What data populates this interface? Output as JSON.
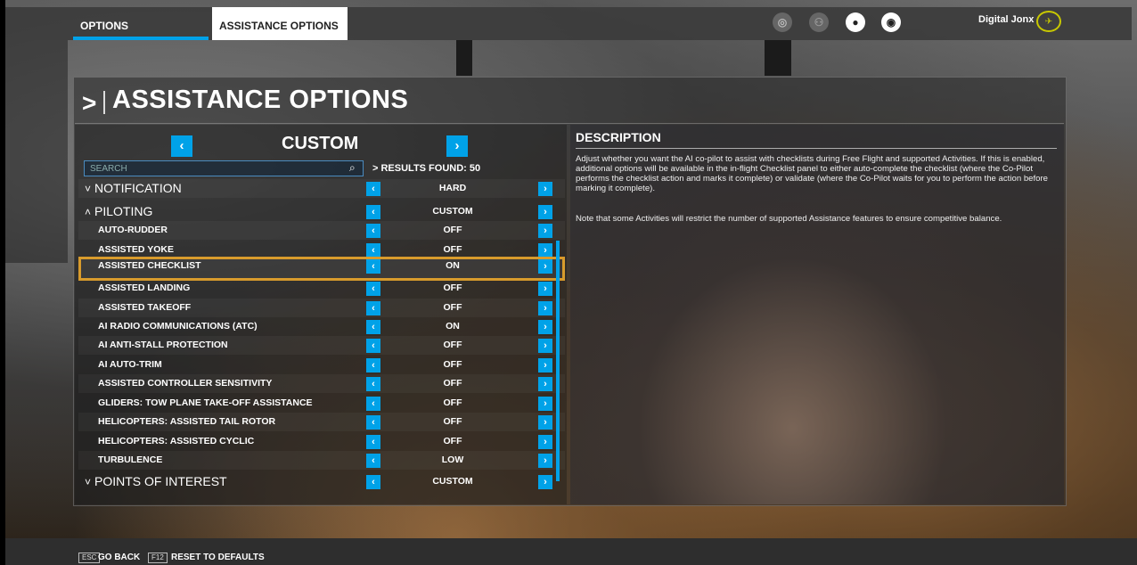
{
  "top_bar": {
    "tab_options": "OPTIONS",
    "tab_assistance": "ASSISTANCE OPTIONS",
    "username": "Digital Jonx",
    "icons": [
      "achievements-icon",
      "friends-icon",
      "profile-icon",
      "notifications-icon"
    ]
  },
  "page": {
    "title": "ASSISTANCE OPTIONS",
    "preset": "CUSTOM",
    "search_placeholder": "SEARCH",
    "results": "RESULTS FOUND: 50"
  },
  "rows": [
    {
      "label": "NOTIFICATION",
      "value": "HARD",
      "type": "category",
      "marker": "˅"
    },
    {
      "label": "PILOTING",
      "value": "CUSTOM",
      "type": "category",
      "marker": "˄"
    },
    {
      "label": "AUTO-RUDDER",
      "value": "OFF",
      "type": "item"
    },
    {
      "label": "ASSISTED YOKE",
      "value": "OFF",
      "type": "item"
    },
    {
      "label": "ASSISTED CHECKLIST",
      "value": "ON",
      "type": "item",
      "selected": true
    },
    {
      "label": "ASSISTED LANDING",
      "value": "OFF",
      "type": "item"
    },
    {
      "label": "ASSISTED TAKEOFF",
      "value": "OFF",
      "type": "item"
    },
    {
      "label": "AI RADIO COMMUNICATIONS (ATC)",
      "value": "ON",
      "type": "item"
    },
    {
      "label": "AI ANTI-STALL PROTECTION",
      "value": "OFF",
      "type": "item"
    },
    {
      "label": "AI AUTO-TRIM",
      "value": "OFF",
      "type": "item"
    },
    {
      "label": "ASSISTED CONTROLLER SENSITIVITY",
      "value": "OFF",
      "type": "item"
    },
    {
      "label": "GLIDERS: TOW PLANE TAKE-OFF ASSISTANCE",
      "value": "OFF",
      "type": "item"
    },
    {
      "label": "HELICOPTERS: ASSISTED TAIL ROTOR",
      "value": "OFF",
      "type": "item"
    },
    {
      "label": "HELICOPTERS: ASSISTED CYCLIC",
      "value": "OFF",
      "type": "item"
    },
    {
      "label": "TURBULENCE",
      "value": "LOW",
      "type": "item"
    },
    {
      "label": "POINTS OF INTEREST",
      "value": "CUSTOM",
      "type": "category",
      "marker": "˅"
    }
  ],
  "description": {
    "heading": "DESCRIPTION",
    "body": "Adjust whether you want the AI co-pilot to assist with checklists during Free Flight and supported Activities. If this is enabled, additional options will be available in the in-flight Checklist panel to either auto-complete the checklist (where the Co-Pilot performs the checklist action and marks it complete) or validate (where the Co-Pilot waits for you to perform the action before marking it complete).",
    "note": "Note that some Activities will restrict the number of supported Assistance features to ensure competitive balance."
  },
  "footer": {
    "esc_key": "ESC",
    "go_back": "GO BACK",
    "f12_key": "F12",
    "reset": "RESET TO DEFAULTS"
  },
  "colors": {
    "accent": "#00a2e8",
    "selection": "#d89b2c"
  }
}
